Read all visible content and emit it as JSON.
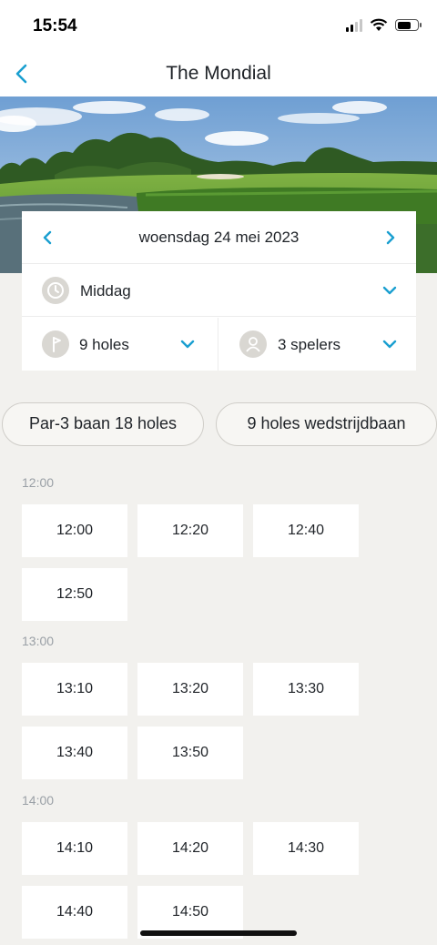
{
  "status": {
    "time": "15:54"
  },
  "nav": {
    "title": "The Mondial"
  },
  "selectors": {
    "date": "woensdag 24 mei 2023",
    "daypart": "Middag",
    "holes": "9 holes",
    "players": "3 spelers"
  },
  "courses": [
    "Par-3 baan 18 holes",
    "9 holes wedstrijdbaan"
  ],
  "slots": [
    {
      "hour": "12:00",
      "times": [
        "12:00",
        "12:20",
        "12:40",
        "12:50"
      ]
    },
    {
      "hour": "13:00",
      "times": [
        "13:10",
        "13:20",
        "13:30",
        "13:40",
        "13:50"
      ]
    },
    {
      "hour": "14:00",
      "times": [
        "14:10",
        "14:20",
        "14:30",
        "14:40",
        "14:50"
      ]
    }
  ],
  "colors": {
    "accent": "#1a9fd0",
    "background": "#f2f1ee",
    "card": "#ffffff",
    "icon_circle": "#d9d7d2"
  },
  "icons": [
    "chevron-left-icon",
    "chevron-right-icon",
    "clock-icon",
    "flag-icon",
    "person-icon",
    "chevron-down-icon",
    "wifi-icon",
    "battery-icon",
    "signal-icon"
  ]
}
